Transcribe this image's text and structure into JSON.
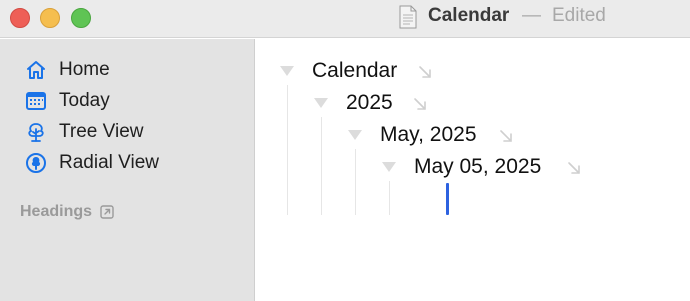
{
  "window": {
    "title": "Calendar",
    "separator": "—",
    "status": "Edited"
  },
  "sidebar": {
    "items": [
      {
        "label": "Home",
        "icon": "house-icon"
      },
      {
        "label": "Today",
        "icon": "calendar-grid-icon"
      },
      {
        "label": "Tree View",
        "icon": "tree-icon"
      },
      {
        "label": "Radial View",
        "icon": "radial-tree-icon"
      }
    ],
    "section_label": "Headings"
  },
  "outline": [
    {
      "label": "Calendar",
      "level": 0,
      "expanded": true
    },
    {
      "label": "2025",
      "level": 1,
      "expanded": true
    },
    {
      "label": "May, 2025",
      "level": 2,
      "expanded": true
    },
    {
      "label": "May 05, 2025",
      "level": 3,
      "expanded": true
    }
  ],
  "colors": {
    "accent": "#2d62e0",
    "icon_blue": "#1a73e8",
    "close": "#ee5f57",
    "minimize": "#f5be4f",
    "maximize": "#5fc454"
  }
}
